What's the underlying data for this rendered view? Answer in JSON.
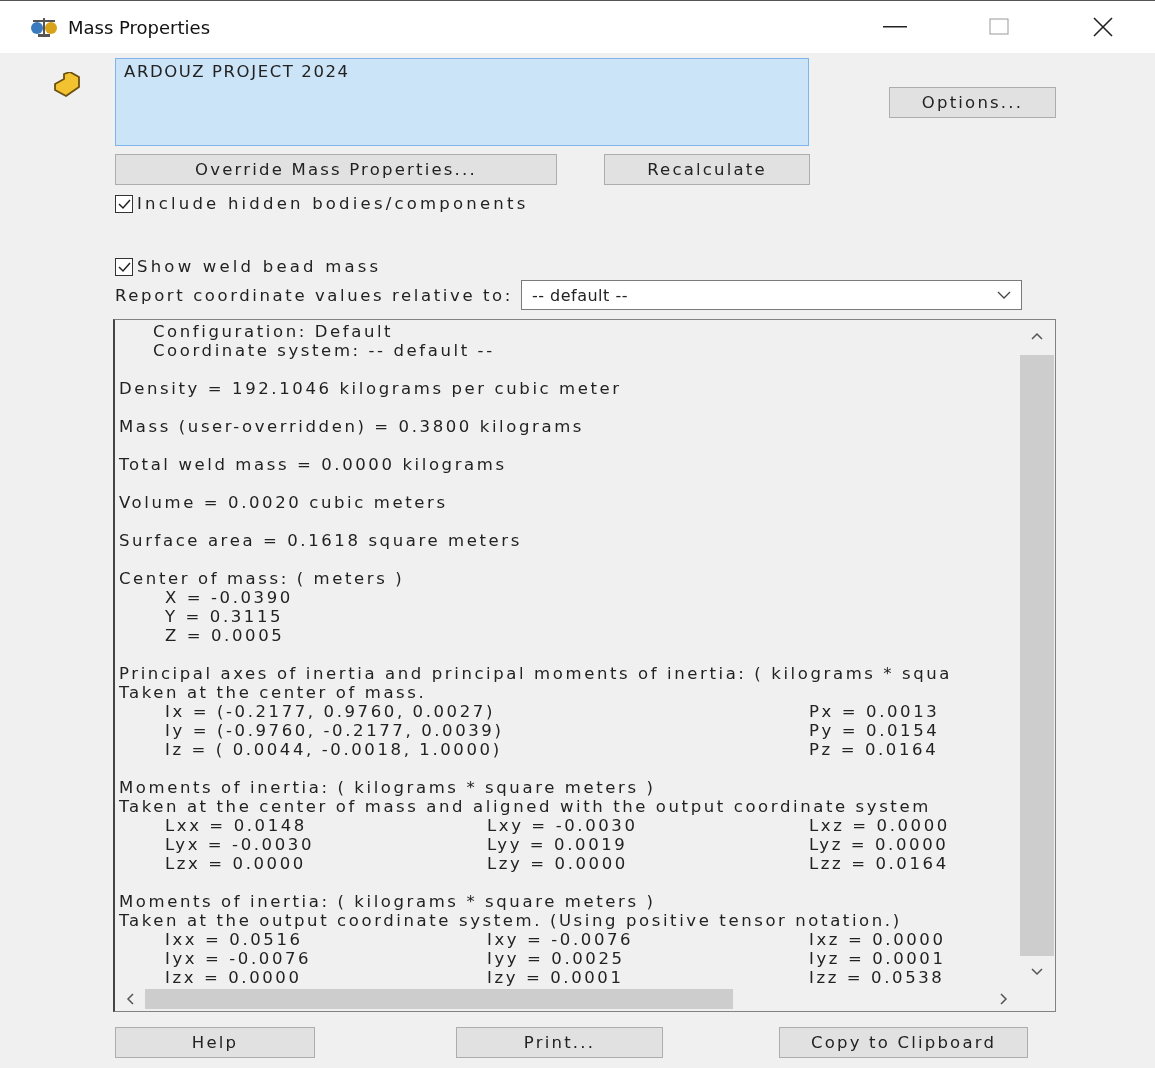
{
  "window": {
    "title": "Mass Properties"
  },
  "selection": {
    "value": "ARDOUZ PROJECT 2024"
  },
  "buttons_top": [
    {
      "label": "Options..."
    },
    {
      "label": "Override Mass Properties..."
    },
    {
      "label": "Recalculate"
    }
  ],
  "checkboxes": [
    {
      "label": "Include hidden bodies/components",
      "checked": true
    },
    {
      "label": "Show weld bead mass",
      "checked": true
    }
  ],
  "coordinate": {
    "label": "Report coordinate values relative to:",
    "value": "-- default --"
  },
  "report": [
    {
      "kind": "indented",
      "lines": [
        "Configuration: Default",
        "Coordinate system: -- default --"
      ]
    },
    {
      "kind": "text",
      "lines": [
        "Density = 192.1046 kilograms per cubic meter"
      ]
    },
    {
      "kind": "text",
      "lines": [
        "Mass (user-overridden) = 0.3800 kilograms"
      ]
    },
    {
      "kind": "text",
      "lines": [
        "Total weld mass = 0.0000 kilograms"
      ]
    },
    {
      "kind": "text",
      "lines": [
        "Volume = 0.0020 cubic meters"
      ]
    },
    {
      "kind": "text",
      "lines": [
        "Surface area = 0.1618 square meters"
      ]
    },
    {
      "kind": "values",
      "lines": [
        "Center of mass: ( meters )"
      ],
      "rows": [
        [
          "X = -0.0390"
        ],
        [
          "Y = 0.3115"
        ],
        [
          "Z = 0.0005"
        ]
      ]
    },
    {
      "kind": "values",
      "lines": [
        "Principal axes of inertia and principal moments of inertia: ( kilograms * squa",
        "Taken at the center of mass."
      ],
      "rows": [
        [
          "Ix = (-0.2177,  0.9760,  0.0027)",
          "Px = 0.0013"
        ],
        [
          "Iy = (-0.9760, -0.2177,  0.0039)",
          "Py = 0.0154"
        ],
        [
          "Iz = ( 0.0044, -0.0018,  1.0000)",
          "Pz = 0.0164"
        ]
      ]
    },
    {
      "kind": "values",
      "lines": [
        "Moments of inertia: ( kilograms * square meters )",
        "Taken at the center of mass and aligned with the output coordinate system"
      ],
      "rows": [
        [
          "Lxx = 0.0148",
          "Lxy = -0.0030",
          "Lxz = 0.0000"
        ],
        [
          "Lyx = -0.0030",
          "Lyy = 0.0019",
          "Lyz = 0.0000"
        ],
        [
          "Lzx = 0.0000",
          "Lzy = 0.0000",
          "Lzz = 0.0164"
        ]
      ]
    },
    {
      "kind": "values",
      "lines": [
        "Moments of inertia: ( kilograms * square meters )",
        "Taken at the output coordinate system. (Using positive tensor notation.)"
      ],
      "rows": [
        [
          "Ixx = 0.0516",
          "Ixy = -0.0076",
          "Ixz = 0.0000"
        ],
        [
          "Iyx = -0.0076",
          "Iyy = 0.0025",
          "Iyz = 0.0001"
        ],
        [
          "Izx = 0.0000",
          "Izy = 0.0001",
          "Izz = 0.0538"
        ]
      ]
    }
  ],
  "buttons_bottom": [
    {
      "label": "Help"
    },
    {
      "label": "Print..."
    },
    {
      "label": "Copy to Clipboard"
    }
  ]
}
